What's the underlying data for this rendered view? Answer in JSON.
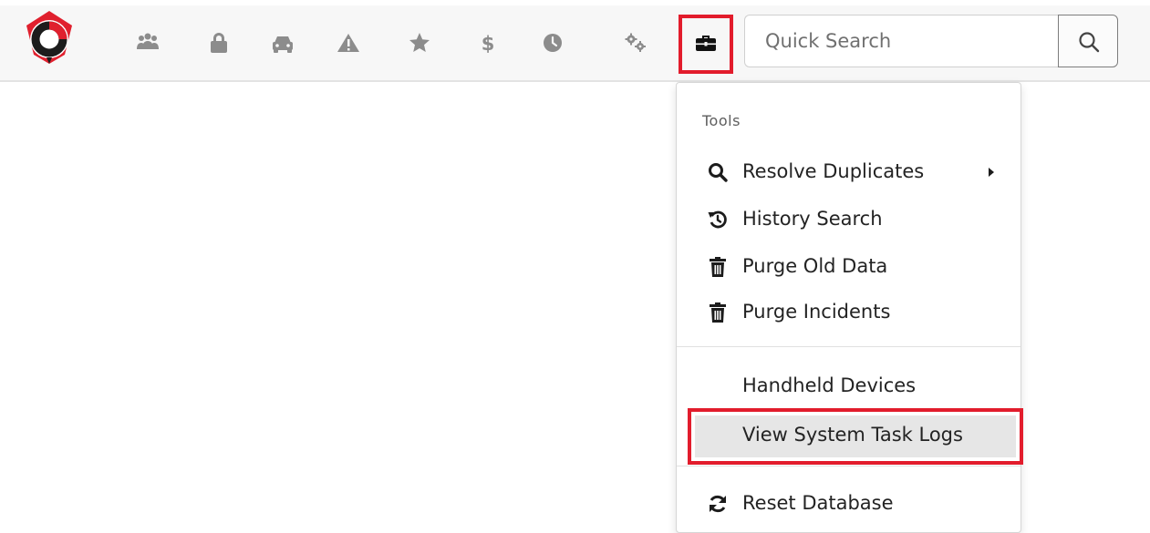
{
  "header": {
    "nav_icons": [
      "users-icon",
      "lock-icon",
      "car-icon",
      "warning-icon",
      "star-icon",
      "dollar-icon",
      "clock-icon",
      "gears-icon"
    ],
    "tools_icon": "toolbox-icon",
    "search": {
      "placeholder": "Quick Search",
      "value": ""
    }
  },
  "tools_menu": {
    "header": "Tools",
    "items": [
      {
        "label": "Resolve Duplicates",
        "icon": "search-icon",
        "has_submenu": true
      },
      {
        "label": "History Search",
        "icon": "history-icon"
      },
      {
        "label": "Purge Old Data",
        "icon": "trash-icon"
      },
      {
        "label": "Purge Incidents",
        "icon": "trash-icon"
      },
      {
        "label": "Handheld Devices"
      },
      {
        "label": "View System Task Logs",
        "highlighted": true
      },
      {
        "label": "Reset Database",
        "icon": "refresh-icon"
      }
    ]
  },
  "colors": {
    "highlight_border": "#e21c2c",
    "icon_gray": "#8c8c8c",
    "icon_dark": "#2a2a2a",
    "logo_red": "#e0202e"
  }
}
